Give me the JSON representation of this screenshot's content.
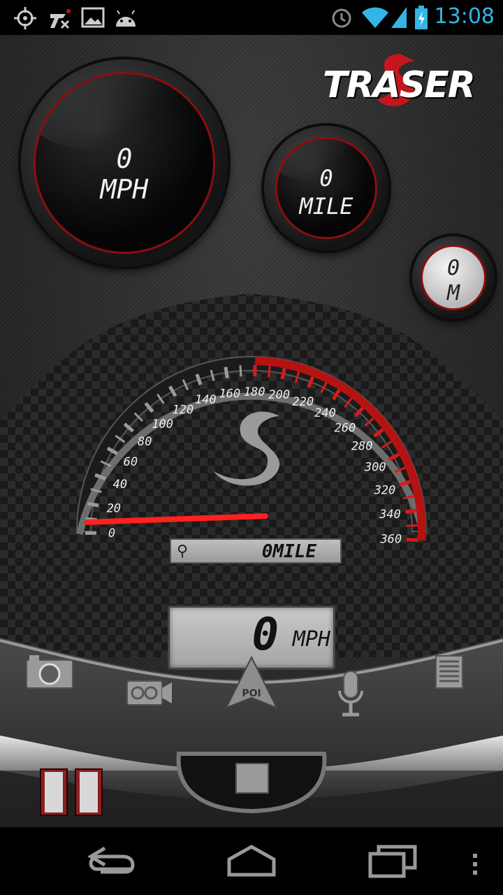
{
  "status_bar": {
    "time": "13:08",
    "icons": [
      "gps-icon",
      "traser-notification-icon",
      "image-icon",
      "android-icon",
      "alarm-icon",
      "wifi-icon",
      "signal-icon",
      "battery-charging-icon"
    ]
  },
  "logo": {
    "text": "TRASER"
  },
  "gauges": {
    "speed": {
      "value": "0",
      "unit": "MPH"
    },
    "distance": {
      "value": "0",
      "unit": "MILE"
    },
    "altitude": {
      "value": "0",
      "unit": "M"
    }
  },
  "speedometer": {
    "ticks": [
      "0",
      "20",
      "40",
      "60",
      "80",
      "100",
      "120",
      "140",
      "160",
      "180",
      "200",
      "220",
      "240",
      "260",
      "280",
      "300",
      "320",
      "340",
      "360"
    ],
    "needle_value": 0,
    "odometer": "0MILE"
  },
  "lcd": {
    "value": "0",
    "unit": "MPH"
  },
  "toolbar": {
    "items": [
      "camera-icon",
      "video-camera-icon",
      "poi-icon",
      "microphone-icon",
      "list-icon"
    ],
    "poi_label": "POI"
  },
  "colors": {
    "accent_red": "#c4161c",
    "status_blue": "#33b5e5"
  },
  "navbar": {
    "items": [
      "back-icon",
      "home-icon",
      "recent-apps-icon",
      "menu-icon"
    ]
  }
}
